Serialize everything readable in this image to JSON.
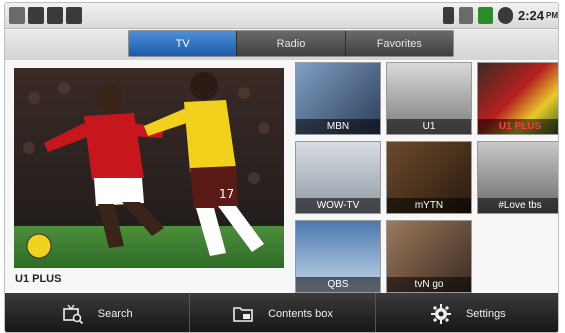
{
  "status_bar": {
    "left_icons": [
      "photo-icon",
      "usb-icon",
      "sd-card-icon",
      "signal-bars-icon"
    ],
    "right_icons": [
      "battery-icon",
      "vibrate-icon",
      "data-icon",
      "alarm-icon"
    ],
    "time": "2:24",
    "ampm": "PM"
  },
  "tabs": [
    {
      "label": "TV",
      "active": true
    },
    {
      "label": "Radio",
      "active": false
    },
    {
      "label": "Favorites",
      "active": false
    }
  ],
  "player": {
    "now_playing": "U1 PLUS",
    "jersey_number": "17"
  },
  "channels": [
    {
      "name": "MBN",
      "highlighted": false
    },
    {
      "name": "U1",
      "highlighted": false
    },
    {
      "name": "U1 PLUS",
      "highlighted": true
    },
    {
      "name": "WOW-TV",
      "highlighted": false
    },
    {
      "name": "mYTN",
      "highlighted": false
    },
    {
      "name": "#Love tbs",
      "highlighted": false
    },
    {
      "name": "QBS",
      "highlighted": false
    },
    {
      "name": "tvN go",
      "highlighted": false
    }
  ],
  "bottom_bar": {
    "search_label": "Search",
    "contents_label": "Contents box",
    "settings_label": "Settings"
  },
  "colors": {
    "active_tab": "#2a6fc6",
    "highlight_channel": "#ff3b3b"
  }
}
